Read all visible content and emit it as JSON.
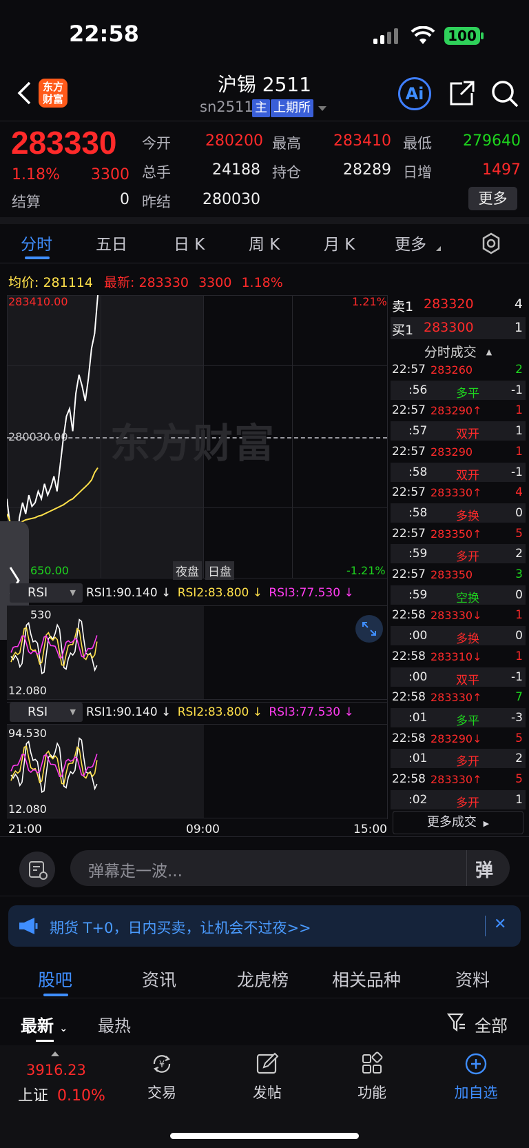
{
  "status": {
    "time": "22:58",
    "battery": "100"
  },
  "header": {
    "title": "沪锡 2511",
    "code": "sn2511",
    "tag_main": "主",
    "tag_exchange": "上期所",
    "ai_label": "Ai",
    "logo_line1": "东方",
    "logo_line2": "财富"
  },
  "quote": {
    "price": "283330",
    "change_pct": "1.18%",
    "change": "3300",
    "fields": {
      "open_label": "今开",
      "open": "280200",
      "high_label": "最高",
      "high": "283410",
      "low_label": "最低",
      "low": "279640",
      "volume_label": "总手",
      "volume": "24188",
      "oi_label": "持仓",
      "oi": "28289",
      "daily_inc_label": "日增",
      "daily_inc": "1497",
      "settle_label": "结算",
      "settle": "0",
      "prev_settle_label": "昨结",
      "prev_settle": "280030"
    },
    "more_label": "更多"
  },
  "chart_tabs": [
    "分时",
    "五日",
    "日 K",
    "周 K",
    "月 K",
    "更多"
  ],
  "chart": {
    "avg_label": "均价:",
    "avg_value": "281114",
    "latest_label": "最新:",
    "latest_value": "283330",
    "latest_change": "3300",
    "latest_pct": "1.18%",
    "y_top": "283410.00",
    "y_mid": "280030.00",
    "y_bottom_partial": "650.00",
    "pct_top": "1.21%",
    "pct_bottom": "-1.21%",
    "session_night": "夜盘",
    "session_day": "日盘",
    "watermark": "东方财富",
    "x_labels": [
      "21:00",
      "09:00",
      "15:00"
    ],
    "rsi1_label": "RSI",
    "rsi_top_1": "530",
    "rsi_bottom_1": "12.080",
    "rsi2_label": "RSI",
    "rsi_top_2": "94.530",
    "rsi_bottom_2": "12.080",
    "rsi1": "RSI1:90.140 ↓",
    "rsi2": "RSI2:83.800 ↓",
    "rsi3": "RSI3:77.530 ↓"
  },
  "chart_data": {
    "type": "line",
    "title": "",
    "ylim": [
      279650,
      283410
    ],
    "prev_settle": 280030,
    "series": [
      {
        "name": "",
        "values": [
          280700,
          280350,
          280100,
          280000,
          280450,
          280650,
          280500,
          280750,
          280600,
          280650,
          280800,
          280700,
          280900,
          280750,
          280850,
          281000,
          280800,
          281150,
          281500,
          281800,
          281900,
          281600,
          282100,
          282350,
          282200,
          282000,
          282300,
          282700,
          282900,
          283410
        ]
      },
      {
        "name": "均价",
        "values": [
          280500,
          280400,
          280350,
          280350,
          280380,
          280400,
          280420,
          280430,
          280440,
          280450,
          280470,
          280480,
          280500,
          280520,
          280540,
          280560,
          280580,
          280600,
          280620,
          280650,
          280680,
          280700,
          280740,
          280780,
          280820,
          280860,
          280900,
          280950,
          281050,
          281114
        ]
      }
    ]
  },
  "orderbook": {
    "ask_label": "卖1",
    "ask_price": "283320",
    "ask_vol": "4",
    "bid_label": "买1",
    "bid_price": "283300",
    "bid_vol": "1",
    "trades_title": "分时成交",
    "more_trades": "更多成交"
  },
  "trades": [
    {
      "time": "22:57",
      "price": "283260",
      "vol": "2",
      "pc": "red",
      "vc": "green"
    },
    {
      "time": ":56",
      "type": "多平",
      "vol": "-1",
      "tc": "green",
      "vc": "white"
    },
    {
      "time": "22:57",
      "price": "283290↑",
      "vol": "1",
      "pc": "red",
      "vc": "red"
    },
    {
      "time": ":57",
      "type": "双开",
      "vol": "1",
      "tc": "red",
      "vc": "white"
    },
    {
      "time": "22:57",
      "price": "283290",
      "vol": "1",
      "pc": "red",
      "vc": "red"
    },
    {
      "time": ":58",
      "type": "双开",
      "vol": "-1",
      "tc": "red",
      "vc": "white"
    },
    {
      "time": "22:57",
      "price": "283330↑",
      "vol": "4",
      "pc": "red",
      "vc": "red"
    },
    {
      "time": ":58",
      "type": "多换",
      "vol": "0",
      "tc": "red",
      "vc": "white"
    },
    {
      "time": "22:57",
      "price": "283350↑",
      "vol": "5",
      "pc": "red",
      "vc": "red"
    },
    {
      "time": ":59",
      "type": "多开",
      "vol": "2",
      "tc": "red",
      "vc": "white"
    },
    {
      "time": "22:57",
      "price": "283350",
      "vol": "3",
      "pc": "red",
      "vc": "green"
    },
    {
      "time": ":59",
      "type": "空换",
      "vol": "0",
      "tc": "green",
      "vc": "white"
    },
    {
      "time": "22:58",
      "price": "283330↓",
      "vol": "1",
      "pc": "red",
      "vc": "red"
    },
    {
      "time": ":00",
      "type": "多换",
      "vol": "0",
      "tc": "red",
      "vc": "white"
    },
    {
      "time": "22:58",
      "price": "283310↓",
      "vol": "1",
      "pc": "red",
      "vc": "red"
    },
    {
      "time": ":00",
      "type": "双平",
      "vol": "-1",
      "tc": "red",
      "vc": "white"
    },
    {
      "time": "22:58",
      "price": "283330↑",
      "vol": "7",
      "pc": "red",
      "vc": "green"
    },
    {
      "time": ":01",
      "type": "多平",
      "vol": "-3",
      "tc": "green",
      "vc": "white"
    },
    {
      "time": "22:58",
      "price": "283290↓",
      "vol": "5",
      "pc": "red",
      "vc": "red"
    },
    {
      "time": ":01",
      "type": "多开",
      "vol": "2",
      "tc": "red",
      "vc": "white"
    },
    {
      "time": "22:58",
      "price": "283330↑",
      "vol": "5",
      "pc": "red",
      "vc": "red"
    },
    {
      "time": ":02",
      "type": "多开",
      "vol": "1",
      "tc": "red",
      "vc": "white"
    }
  ],
  "danmu": {
    "placeholder": "弹幕走一波...",
    "send_label": "弹"
  },
  "banner": {
    "text": "期货 T+0，日内买卖，让机会不过夜>>",
    "close": "✕"
  },
  "bottom_tabs": [
    "股吧",
    "资讯",
    "龙虎榜",
    "相关品种",
    "资料"
  ],
  "feed": {
    "latest": "最新",
    "hottest": "最热",
    "filter": "全部"
  },
  "nav": {
    "index_value": "3916.23",
    "index_name": "上证",
    "index_pct": "0.10%",
    "trade": "交易",
    "post": "发帖",
    "functions": "功能",
    "add_watch": "加自选"
  },
  "colors": {
    "up": "#ff2a2a",
    "down": "#1ed51e",
    "accent": "#3f8eff",
    "avg": "#ffe04a",
    "rsi3": "#ff3cf0"
  }
}
